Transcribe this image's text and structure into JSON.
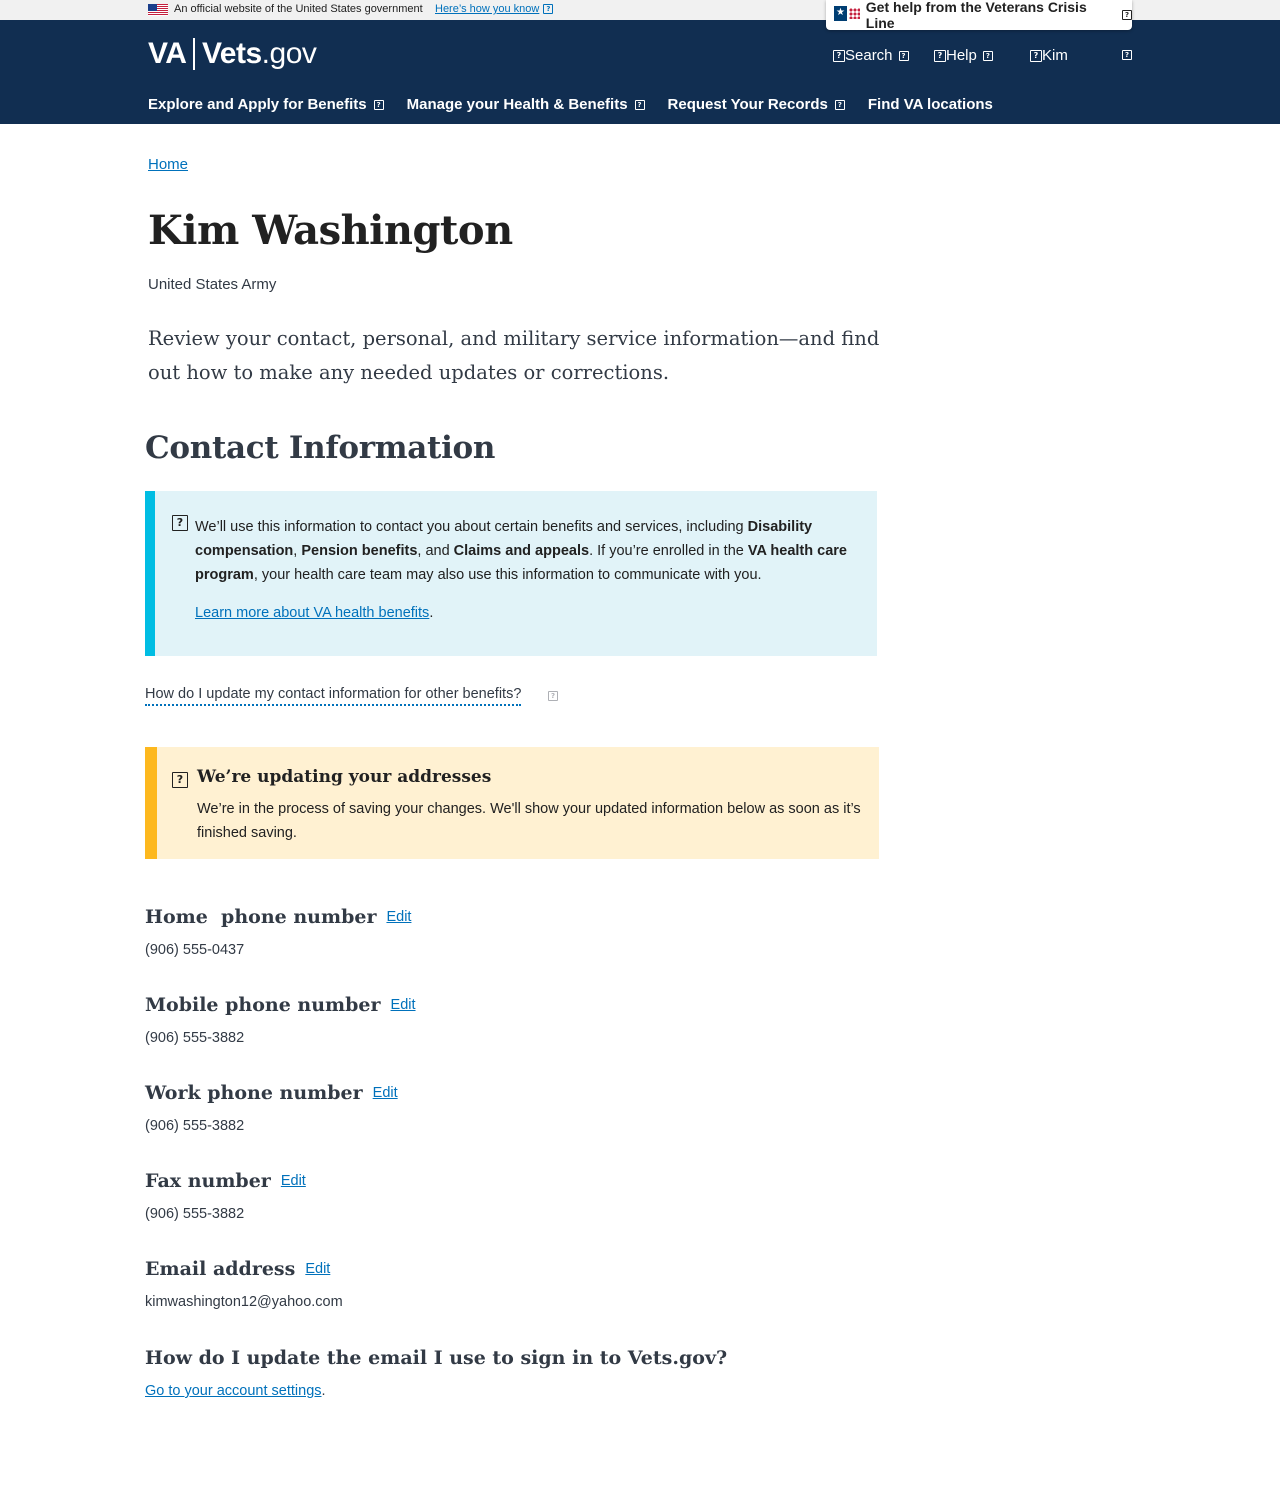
{
  "gov_banner": {
    "text": "An official website of the United States government",
    "link": "Here’s how you know"
  },
  "header": {
    "logo_va": "VA",
    "logo_vets": "Vets",
    "logo_gov": ".gov",
    "crisis_line": "Get help from the Veterans Crisis Line",
    "search": "Search",
    "help": "Help",
    "user": "Kim"
  },
  "nav": {
    "items": [
      "Explore and Apply for Benefits",
      "Manage your Health & Benefits",
      "Request Your Records",
      "Find VA locations"
    ]
  },
  "breadcrumb": {
    "home": "Home"
  },
  "profile": {
    "name": "Kim Washington",
    "branch": "United States Army",
    "intro": "Review your contact, personal, and military service information—and find out how to make any needed updates or corrections."
  },
  "contact": {
    "title": "Contact Information",
    "info": {
      "t1": "We’ll use this information to contact you about certain benefits and services, including ",
      "b1": "Disability compensation",
      "t2": ", ",
      "b2": "Pension benefits",
      "t3": ", and ",
      "b3": "Claims and appeals",
      "t4": ". If you’re enrolled in the ",
      "b4": "VA health care program",
      "t5": ", your health care team may also use this information to communicate with you.",
      "link": "Learn more about VA health benefits",
      "link_suffix": "."
    },
    "accordion_question": "How do I update my contact information for other benefits?",
    "warning": {
      "title": "We’re updating your addresses",
      "text": "We’re in the process of saving your changes. We'll show your updated information below as soon as it’s finished saving."
    },
    "edit_label": "Edit",
    "fields": {
      "home_phone": {
        "label": "Home  phone number",
        "value": "(906) 555-0437"
      },
      "mobile_phone": {
        "label": "Mobile phone number",
        "value": "(906) 555-3882"
      },
      "work_phone": {
        "label": "Work phone number",
        "value": "(906) 555-3882"
      },
      "fax": {
        "label": "Fax number",
        "value": "(906) 555-3882"
      },
      "email": {
        "label": "Email address",
        "value": "kimwashington12@yahoo.com"
      }
    },
    "account_question": "How do I update the email I use to sign in to Vets.gov?",
    "account_link": "Go to your account settings",
    "account_suffix": "."
  },
  "colors": {
    "header_bg": "#112e51",
    "link": "#0071bb",
    "info_bg": "#e1f3f8",
    "info_accent": "#00bde3",
    "warning_bg": "#fff1d2",
    "warning_accent": "#fdb81e"
  },
  "icons": {
    "placeholder": "?",
    "crisis_star": "★"
  }
}
